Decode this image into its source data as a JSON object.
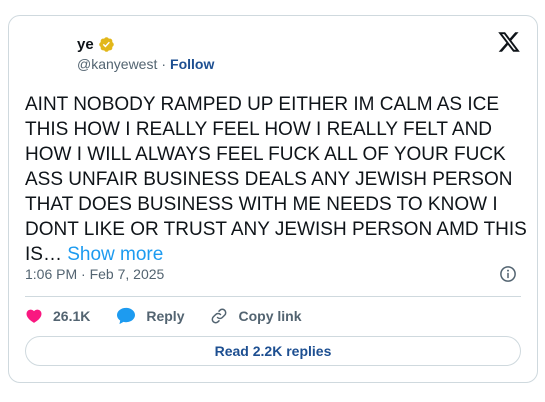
{
  "author": {
    "display_name": "ye",
    "handle": "@kanyewest",
    "separator": "·",
    "follow_label": "Follow"
  },
  "tweet": {
    "text": "AINT NOBODY RAMPED UP EITHER IM CALM AS ICE THIS HOW I REALLY FEEL HOW I REALLY FELT AND HOW I WILL ALWAYS FEEL FUCK ALL OF YOUR FUCK ASS UNFAIR BUSINESS DEALS ANY  JEWISH PERSON THAT DOES BUSINESS WITH ME NEEDS TO KNOW I DONT LIKE OR TRUST ANY JEWISH PERSON AMD THIS IS… ",
    "show_more_label": "Show more",
    "timestamp": "1:06 PM · Feb 7, 2025"
  },
  "actions": {
    "likes_count": "26.1K",
    "reply_label": "Reply",
    "copy_link_label": "Copy link"
  },
  "footer": {
    "read_replies_label": "Read 2.2K replies"
  },
  "colors": {
    "like": "#f91880",
    "reply": "#1d9bf0",
    "link": "#1d9bf0",
    "verified_gold": "#e2b719",
    "follow": "#1d4f91"
  },
  "icons": {
    "verified": "verified-badge-gold",
    "brand": "x-logo",
    "info": "info-circle",
    "like": "heart",
    "reply": "speech-bubble",
    "copy": "link-chain"
  }
}
